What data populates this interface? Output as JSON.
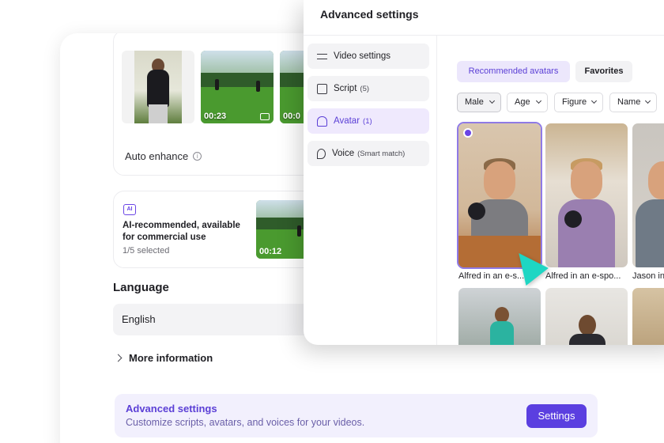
{
  "media": {
    "thumbnails": [
      {
        "duration": ""
      },
      {
        "duration": "00:23"
      },
      {
        "duration": "00:0"
      }
    ],
    "auto_enhance_label": "Auto enhance",
    "info_symbol": "i"
  },
  "ai_card": {
    "icon_text": "AI",
    "title": "AI-recommended, available for commercial use",
    "selected_count": "1/5 selected",
    "clip_duration": "00:12"
  },
  "language": {
    "label": "Language",
    "value": "English"
  },
  "more_information_label": "More information",
  "advanced_banner": {
    "title": "Advanced settings",
    "description": "Customize scripts, avatars, and voices for your videos.",
    "button_label": "Settings"
  },
  "advanced_panel": {
    "title": "Advanced settings",
    "sidebar": [
      {
        "label": "Video settings",
        "count": "",
        "icon": "sliders-icon"
      },
      {
        "label": "Script",
        "count": "(5)",
        "icon": "script-icon"
      },
      {
        "label": "Avatar",
        "count": "(1)",
        "icon": "avatar-icon"
      },
      {
        "label": "Voice",
        "count": "(Smart match)",
        "icon": "voice-icon"
      }
    ],
    "tabs": [
      {
        "label": "Recommended avatars"
      },
      {
        "label": "Favorites"
      }
    ],
    "filters": [
      {
        "label": "Male"
      },
      {
        "label": "Age"
      },
      {
        "label": "Figure"
      },
      {
        "label": "Name"
      }
    ],
    "avatars": [
      {
        "name": "Alfred in an e-s..."
      },
      {
        "name": "Alfred in an e-spo..."
      },
      {
        "name": "Jason in"
      }
    ]
  },
  "colors": {
    "accent": "#5b3fe0",
    "accent_soft": "#efe9fd",
    "cursor": "#1ed6c3"
  }
}
